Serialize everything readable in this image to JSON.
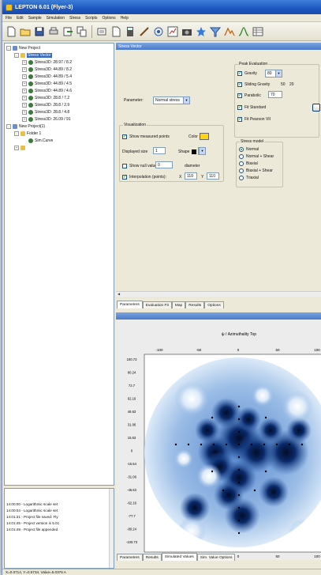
{
  "window": {
    "title": "LEPTON 6.01 (Flyer-3)"
  },
  "menu": [
    "File",
    "Edit",
    "Sample",
    "Simulation",
    "Stress",
    "Scripts",
    "Options",
    "Help"
  ],
  "tree": [
    {
      "label": "New Project",
      "level": 0,
      "exp": "-"
    },
    {
      "label": "Stress Vector",
      "level": 1,
      "exp": "-",
      "selected": true
    },
    {
      "label": "Stress3D: 28.97 / 8.2",
      "level": 2,
      "exp": "+"
    },
    {
      "label": "Stress3D: 44.89 / 8.2",
      "level": 2,
      "exp": "+"
    },
    {
      "label": "Stress3D: 44.89 / 5.4",
      "level": 2,
      "exp": "+"
    },
    {
      "label": "Stress3D: 44.89 / 4.5",
      "level": 2,
      "exp": "+"
    },
    {
      "label": "Stress3D: 44.89 / 4.6",
      "level": 2,
      "exp": "+"
    },
    {
      "label": "Stress3D: 28.8 / 7.2",
      "level": 2,
      "exp": "+"
    },
    {
      "label": "Stress3D: 28.8 / 2.9",
      "level": 2,
      "exp": "+"
    },
    {
      "label": "Stress3D: 28.8 / 4.8",
      "level": 2,
      "exp": "+"
    },
    {
      "label": "Stress3D: 26.09 / 91",
      "level": 2,
      "exp": "+"
    },
    {
      "label": "New Project(1)",
      "level": 0,
      "exp": "-"
    },
    {
      "label": "Folder 1",
      "level": 1,
      "exp": "-"
    },
    {
      "label": "Sim.Curve",
      "level": 2,
      "exp": ""
    },
    {
      "label": "",
      "level": 1,
      "exp": "+"
    }
  ],
  "log": [
    "14:00:00 - Logarithmic scale set",
    "14:00:04 - Logarithmic scale set",
    "14:01:31 - Project file saved: Fly",
    "14:01:45 - Project version is 5.01",
    "14:01:49 - Project file appended"
  ],
  "settings": {
    "header": "Stress Vector",
    "parameter_label": "Parameter:",
    "parameter_value": "Normal stress",
    "visualization_title": "Visualization",
    "show_points": "Show measured points",
    "color_label": "Color",
    "displayed_size_label": "Displayed size",
    "displayed_size_value": "1",
    "shape_label": "Shape",
    "show_null_label": "Show null value",
    "show_null_value": "0",
    "diameter_label": "diameter",
    "interp_label": "Interpolation (points):",
    "interp_x_label": "X",
    "interp_x": "110",
    "interp_y_label": "Y",
    "interp_y": "110",
    "peak_title": "Peak Evaluation",
    "gravity_label": "Gravity",
    "gravity_value": "80",
    "sliding_label": "Sliding Gravity",
    "sliding_value": "50",
    "sliding_value2": "20",
    "parabolic_label": "Parabolic",
    "parabolic_value": "70",
    "fit_standard": "Fit Standard",
    "fit_pearson": "Fit Pearson VII",
    "stress_model_title": "Stress model",
    "models": [
      "Normal",
      "Normal + Shear",
      "Biaxial",
      "Biaxial + Shear",
      "Triaxial"
    ],
    "tabs": [
      "Parameters",
      "Evaluation Fit",
      "Map",
      "Results",
      "Options"
    ]
  },
  "plot": {
    "title": "ψ / Azimuthality Top",
    "x_ticks": [
      "-100",
      "-50",
      "0",
      "50",
      "100"
    ],
    "y_ticks": [
      "100.73",
      "80.24",
      "72.7",
      "62.16",
      "46.63",
      "31.06",
      "15.53",
      "0",
      "-15.54",
      "-31.06",
      "-46.63",
      "-62.16",
      "-77.7",
      "-80.24",
      "-100.73"
    ],
    "tabs": [
      "Parameters",
      "Results",
      "Simulated Values",
      "Sim. Value Options"
    ]
  },
  "status": "X=0.0714, Y=0.5734, Value=5.0376 A",
  "colors": {
    "title_bar": "#1c58c0",
    "accent": "#316ac5",
    "plot_dark": "#0a2a6a",
    "plot_light": "#dceaf8"
  }
}
